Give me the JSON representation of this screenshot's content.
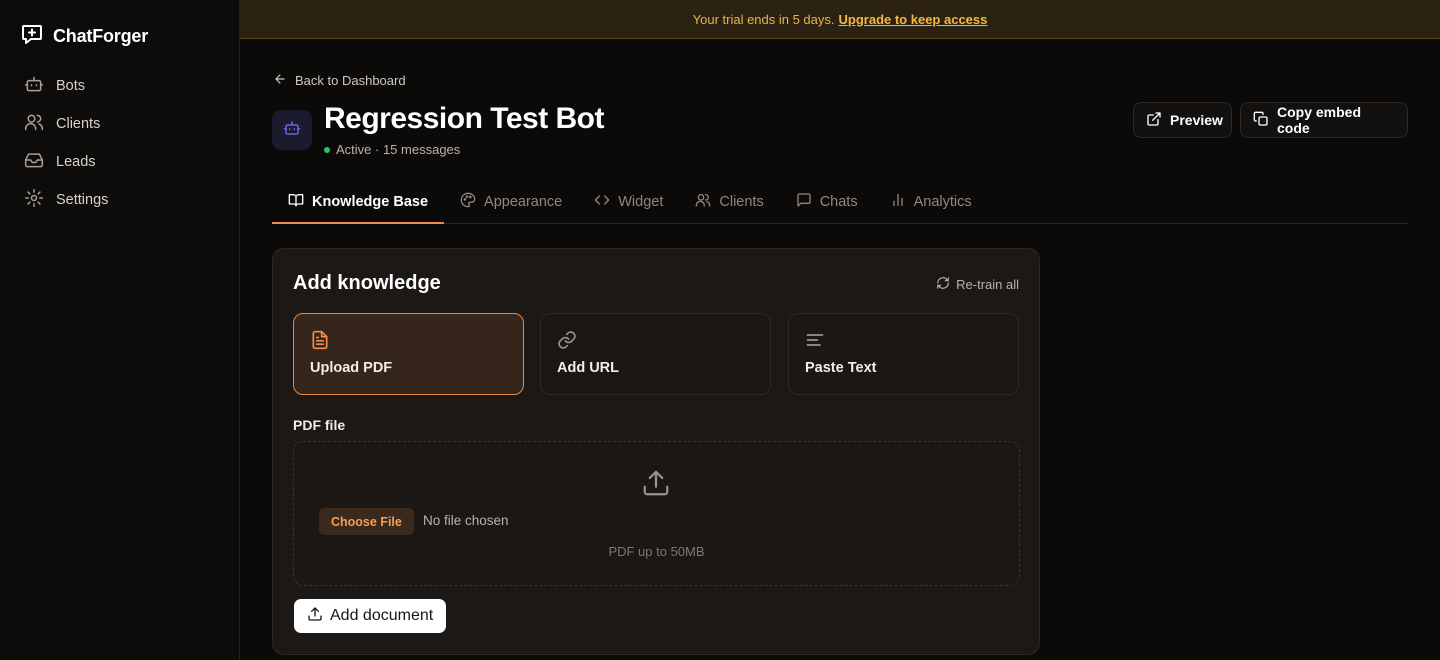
{
  "app": {
    "name": "ChatForger"
  },
  "sidebar": {
    "items": [
      {
        "label": "Bots",
        "icon": "bot-icon"
      },
      {
        "label": "Clients",
        "icon": "users-icon"
      },
      {
        "label": "Leads",
        "icon": "inbox-icon"
      },
      {
        "label": "Settings",
        "icon": "gear-icon"
      }
    ]
  },
  "banner": {
    "text": "Your trial ends in 5 days.",
    "link": "Upgrade to keep access"
  },
  "header": {
    "back_label": "Back to Dashboard",
    "bot_name": "Regression Test Bot",
    "status": "Active · 15 messages",
    "preview_label": "Preview",
    "embed_label": "Copy embed code"
  },
  "tabs": [
    {
      "label": "Knowledge Base",
      "icon": "book-icon",
      "active": true
    },
    {
      "label": "Appearance",
      "icon": "palette-icon"
    },
    {
      "label": "Widget",
      "icon": "code-icon"
    },
    {
      "label": "Clients",
      "icon": "users-icon"
    },
    {
      "label": "Chats",
      "icon": "message-icon"
    },
    {
      "label": "Analytics",
      "icon": "bar-chart-icon"
    }
  ],
  "knowledge": {
    "title": "Add knowledge",
    "retrain_label": "Re-train all",
    "options": [
      {
        "label": "Upload PDF",
        "icon": "file-text-icon",
        "selected": true
      },
      {
        "label": "Add URL",
        "icon": "link-icon"
      },
      {
        "label": "Paste Text",
        "icon": "text-lines-icon"
      }
    ],
    "field_label": "PDF file",
    "choose_label": "Choose File",
    "file_status": "No file chosen",
    "hint": "PDF up to 50MB",
    "submit_label": "Add document"
  },
  "colors": {
    "accent": "#f28c4a",
    "warning": "#f5b942",
    "status_active": "#22c55e"
  }
}
